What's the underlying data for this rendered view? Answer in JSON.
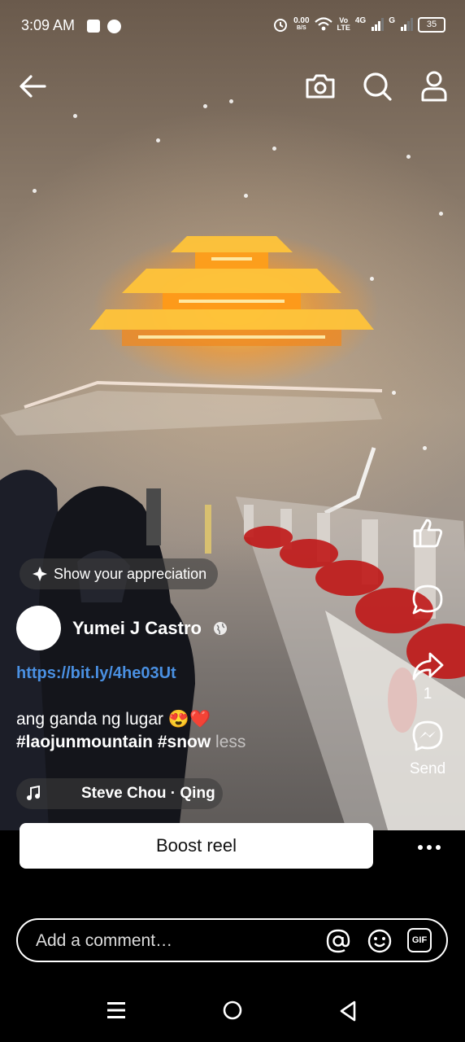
{
  "status_bar": {
    "time": "3:09 AM",
    "net_speed_value": "0.00",
    "net_speed_unit": "B/S",
    "volte_top": "Vo",
    "volte_bottom": "LTE",
    "network_4g": "4G",
    "network_g": "G",
    "battery": "35",
    "icons": [
      "square-icon",
      "dot-icon",
      "alarm-icon",
      "wifi-icon",
      "signal-icon",
      "signal-icon-2",
      "battery-icon"
    ]
  },
  "top_bar": {
    "icons": [
      "back-arrow-icon",
      "camera-icon",
      "search-icon",
      "profile-icon"
    ]
  },
  "video": {
    "appreciation_label": "Show your appreciation",
    "author_name": "Yumei J Castro",
    "link": "https://bit.ly/4he03Ut",
    "caption_text": "ang ganda ng lugar 😍❤️",
    "hashtags": "#laojunmountain #snow",
    "less_label": "less",
    "music_track": "Steve Chou · Qing"
  },
  "side_actions": {
    "share_count": "1",
    "send_label": "Send",
    "icons": [
      "like-icon",
      "comment-icon",
      "share-icon",
      "messenger-icon"
    ]
  },
  "boost": {
    "label": "Boost reel"
  },
  "comment": {
    "placeholder": "Add a comment…",
    "gif_label": "GIF",
    "icons": [
      "mention-icon",
      "emoji-icon",
      "gif-icon"
    ]
  },
  "nav_bar": {
    "icons": [
      "recents-icon",
      "home-icon",
      "back-icon"
    ]
  },
  "colors": {
    "link": "#4a90e2",
    "lantern_glow": "#ffb020",
    "ribbon_red": "#c01818"
  }
}
